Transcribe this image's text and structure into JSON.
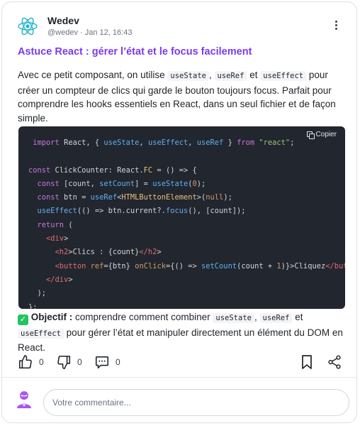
{
  "post": {
    "author": "Wedev",
    "handle": "@wedev",
    "date": "Jan 12, 16:43",
    "title": "Astuce React : gérer l’état et le focus facilement",
    "desc": {
      "p1": "Avec ce petit composant, on utilise",
      "c1": "useState",
      "sep1": ",",
      "c2": "useRef",
      "p2": "et",
      "c3": "useEffect",
      "p3": "pour créer un compteur de clics qui garde le bouton toujours focus. Parfait pour comprendre les hooks essentiels en React, dans un seul fichier et de façon simple."
    }
  },
  "code": {
    "copy_label": "Copier",
    "text": " import React, { useState, useEffect, useRef } from \"react\";\n\nconst ClickCounter: React.FC = () => {\n  const [count, setCount] = useState(0);\n  const btn = useRef<HTMLButtonElement>(null);\n  useEffect(() => btn.current?.focus(), [count]);\n  return (\n    <div>\n      <h2>Clics : {count}</h2>\n      <button ref={btn} onClick={() => setCount(count + 1)}>Cliquez</button>\n    </div>\n  );\n};"
  },
  "objective": {
    "label": "Objectif :",
    "p1": "comprendre comment combiner",
    "c1": "useState",
    "sep1": ",",
    "c2": "useRef",
    "p2": "et",
    "c3": "useEffect",
    "p3": "pour gérer l’état et manipuler directement un élément du DOM en React."
  },
  "actions": {
    "likes": "0",
    "dislikes": "0",
    "comments": "0"
  },
  "comment": {
    "placeholder": "Votre commentaire..."
  },
  "colors": {
    "brand": "#7c3aed",
    "code_bg": "#22262e",
    "check": "#22c55e"
  },
  "icons": [
    "react-logo-icon",
    "more-vertical-icon",
    "copy-icon",
    "check-icon",
    "thumbs-up-icon",
    "thumbs-down-icon",
    "comment-icon",
    "bookmark-icon",
    "share-icon",
    "user-avatar-icon"
  ]
}
